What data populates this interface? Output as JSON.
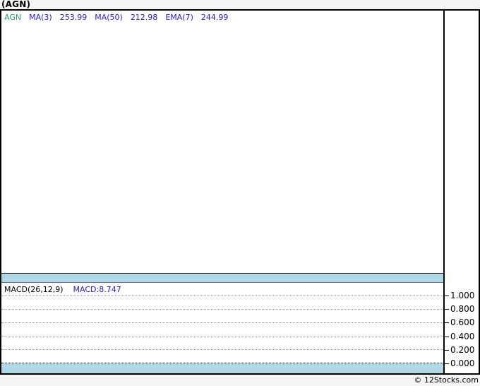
{
  "page": {
    "title": "(AGN)",
    "footer": "© 12Stocks.com"
  },
  "price_legend": {
    "ticker": "AGN",
    "items": [
      {
        "label": "MA(3)",
        "value": "253.99"
      },
      {
        "label": "MA(50)",
        "value": "212.98"
      },
      {
        "label": "EMA(7)",
        "value": "244.99"
      }
    ]
  },
  "macd_panel": {
    "params": "MACD(26,12,9)",
    "value": "MACD:8.747",
    "axis_ticks": [
      "1.000",
      "0.800",
      "0.600",
      "0.400",
      "0.200",
      "0.000"
    ]
  },
  "colors": {
    "ticker_green": "#339966",
    "legend_blue": "#2222cc",
    "band_blue": "#aed8e6",
    "grid_gray": "#999999",
    "zero_line": "#111111",
    "page_background": "#f4f4f4"
  },
  "chart_data": [
    {
      "type": "line",
      "title": "(AGN) price panel",
      "series": [
        {
          "name": "AGN",
          "color": "#339966",
          "values": []
        },
        {
          "name": "MA(3)",
          "last_value": 253.99,
          "values": []
        },
        {
          "name": "MA(50)",
          "last_value": 212.98,
          "values": []
        },
        {
          "name": "EMA(7)",
          "last_value": 244.99,
          "values": []
        }
      ],
      "legend_position": "top-left",
      "grid": false
    },
    {
      "type": "line",
      "title": "MACD(26,12,9)",
      "series": [
        {
          "name": "MACD",
          "last_value": 8.747,
          "values": []
        }
      ],
      "ylim": [
        0.0,
        1.0
      ],
      "yticks": [
        1.0,
        0.8,
        0.6,
        0.4,
        0.2,
        0.0
      ],
      "ytick_labels": [
        "1.000",
        "0.800",
        "0.600",
        "0.400",
        "0.200",
        "0.000"
      ],
      "grid": "dotted horizontal",
      "legend_position": "top-left",
      "axis_position": "right"
    }
  ]
}
